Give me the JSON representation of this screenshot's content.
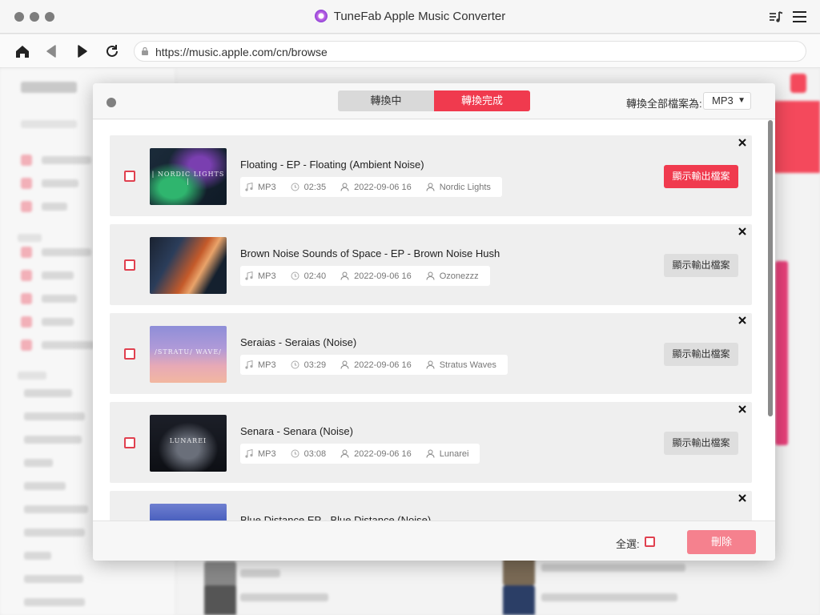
{
  "window": {
    "title": "TuneFab Apple Music Converter"
  },
  "navbar": {
    "url": "https://music.apple.com/cn/browse"
  },
  "modal": {
    "tabs": [
      {
        "label": "轉換中",
        "active": false
      },
      {
        "label": "轉換完成",
        "active": true
      }
    ],
    "convert_all_label": "轉換全部檔案為:",
    "format_value": "MP3",
    "items": [
      {
        "title": "Floating - EP - Floating (Ambient Noise)",
        "cover_text": "| NORDIC LIGHTS |",
        "format": "MP3",
        "duration": "02:35",
        "date": "2022-09-06 16",
        "artist": "Nordic Lights",
        "button": "顯示輸出檔案",
        "highlighted": true
      },
      {
        "title": "Brown Noise Sounds of Space - EP - Brown Noise Hush",
        "cover_text": "",
        "format": "MP3",
        "duration": "02:40",
        "date": "2022-09-06 16",
        "artist": "Ozonezzz",
        "button": "顯示輸出檔案",
        "highlighted": false
      },
      {
        "title": "Seraias - Seraias (Noise)",
        "cover_text": "/STRATU/ WAVE/",
        "format": "MP3",
        "duration": "03:29",
        "date": "2022-09-06 16",
        "artist": "Stratus Waves",
        "button": "顯示輸出檔案",
        "highlighted": false
      },
      {
        "title": "Senara - Senara (Noise)",
        "cover_text": "LUNAREI",
        "format": "MP3",
        "duration": "03:08",
        "date": "2022-09-06 16",
        "artist": "Lunarei",
        "button": "顯示輸出檔案",
        "highlighted": false
      },
      {
        "title": "Blue Distance EP - Blue Distance (Noise)",
        "cover_text": "",
        "format": "",
        "duration": "",
        "date": "",
        "artist": "",
        "button": "",
        "highlighted": false
      }
    ],
    "select_all_label": "全選:",
    "delete_label": "刪除"
  },
  "colors": {
    "accent": "#f03a4e",
    "delete_disabled": "#f5818e"
  }
}
